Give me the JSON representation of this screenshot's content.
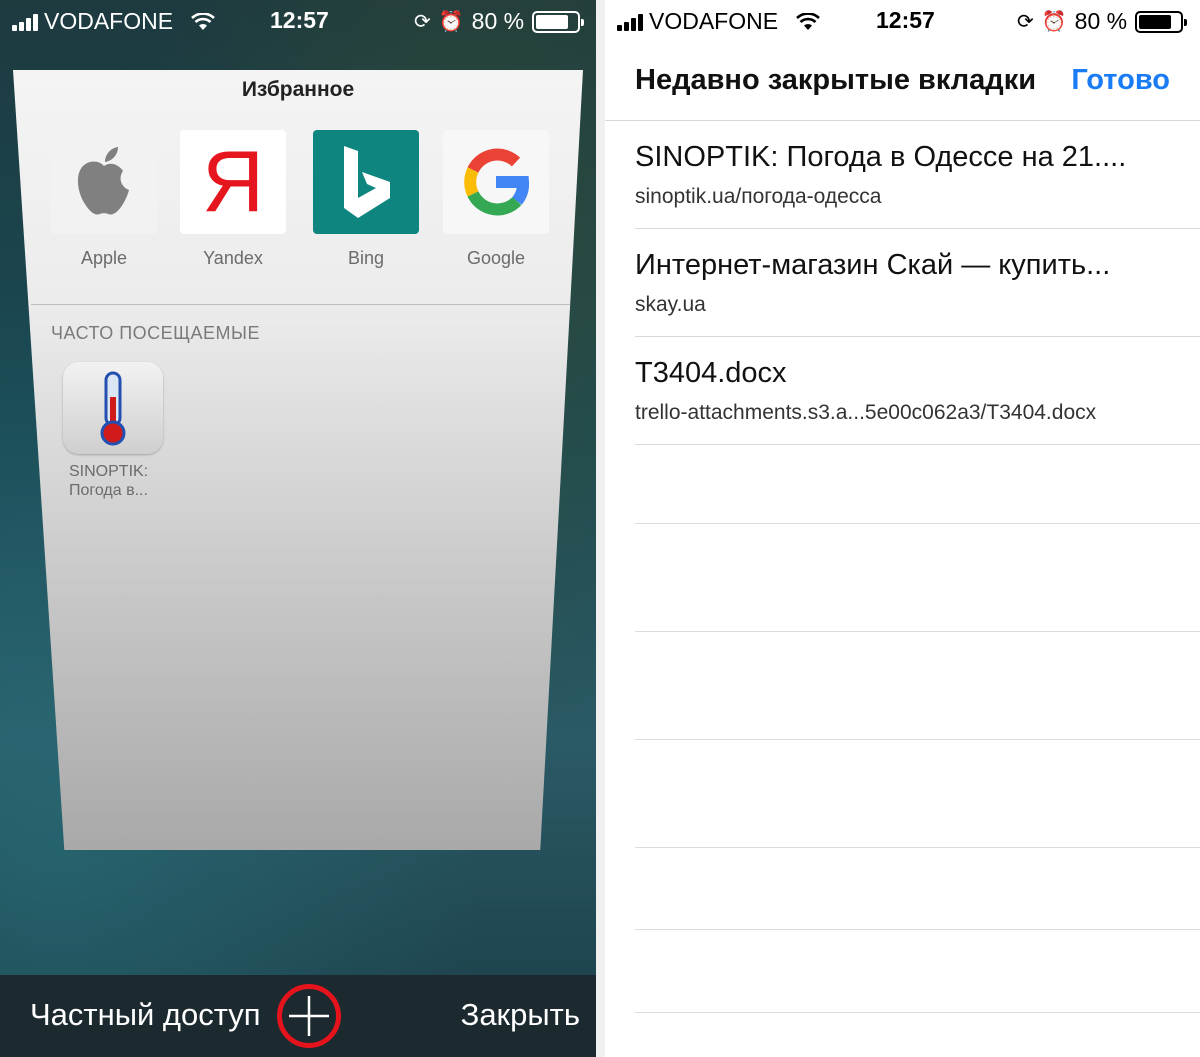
{
  "status_bar": {
    "carrier": "VODAFONE",
    "time": "12:57",
    "battery": "80 %"
  },
  "left": {
    "favorites_title": "Избранное",
    "favorites": [
      {
        "label": "Apple",
        "icon": "apple-icon"
      },
      {
        "label": "Yandex",
        "icon": "yandex-icon",
        "glyph": "Я"
      },
      {
        "label": "Bing",
        "icon": "bing-icon"
      },
      {
        "label": "Google",
        "icon": "google-icon"
      }
    ],
    "frequent_title": "ЧАСТО ПОСЕЩАЕМЫЕ",
    "frequent": [
      {
        "label_line1": "SINOPTIK:",
        "label_line2": "Погода в...",
        "icon": "thermometer-icon"
      }
    ],
    "toolbar": {
      "private": "Частный доступ",
      "close": "Закрыть"
    },
    "colors": {
      "highlight_ring": "#e5131c",
      "bing_tile": "#0f8580",
      "yandex_red": "#e6161f"
    }
  },
  "right": {
    "title": "Недавно закрытые вкладки",
    "done": "Готово",
    "done_color": "#1a7cf5",
    "tabs": [
      {
        "title": "SINOPTIK: Погода в Одессе на 21....",
        "url": "sinoptik.ua/погода-одесса"
      },
      {
        "title": "Интернет-магазин Скай — купить...",
        "url": "skay.ua"
      },
      {
        "title": "T3404.docx",
        "url": "trello-attachments.s3.a...5e00c062a3/T3404.docx"
      }
    ]
  }
}
